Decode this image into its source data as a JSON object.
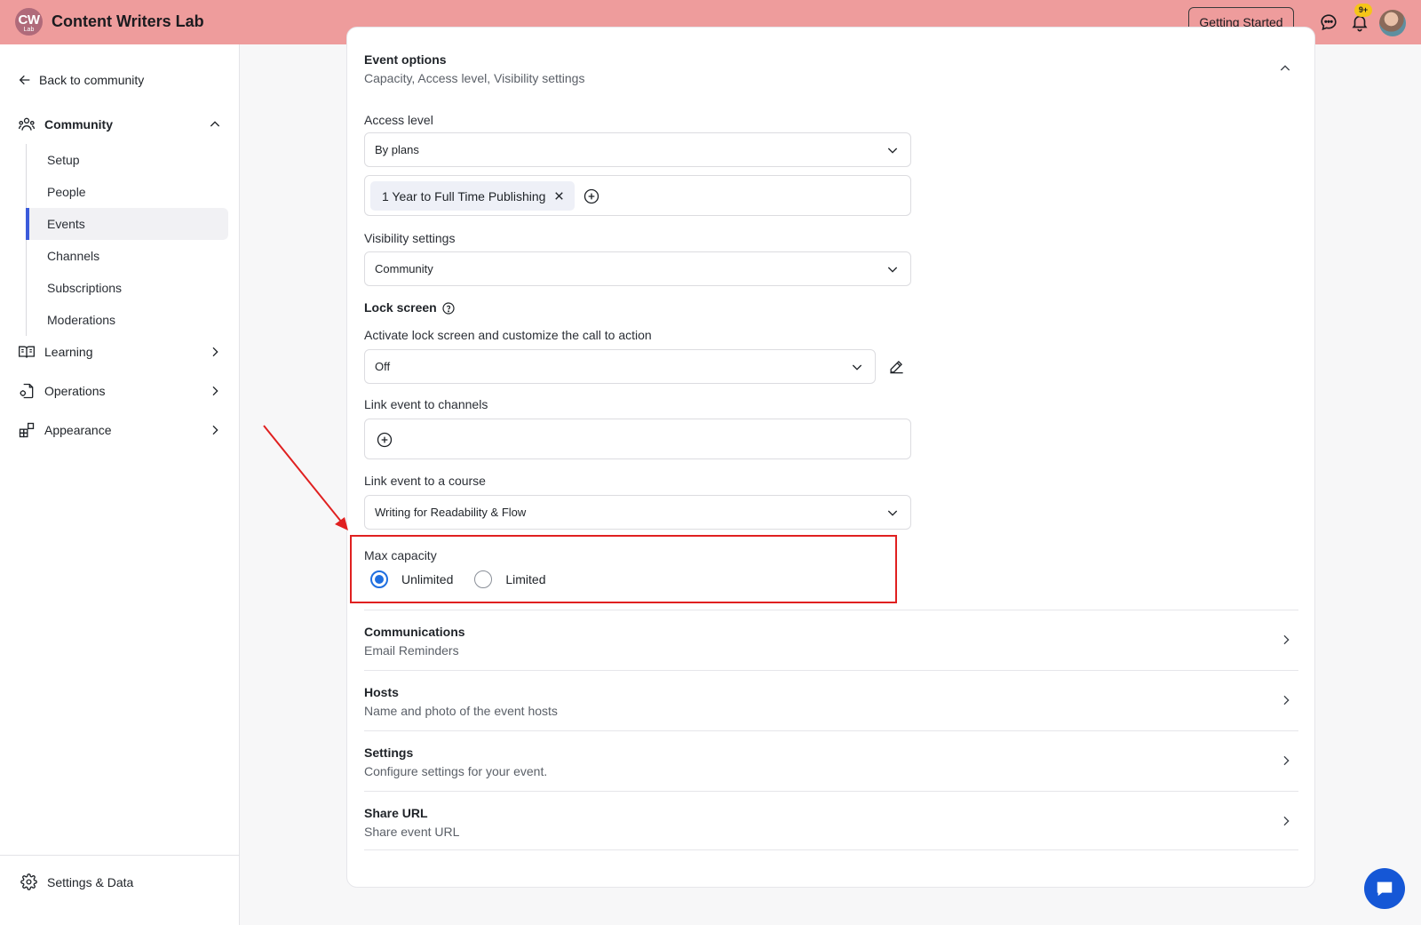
{
  "header": {
    "logo_text": "CW",
    "logo_sub": "Lab",
    "brand": "Content Writers Lab",
    "getting_started": "Getting Started",
    "notif_badge": "9+"
  },
  "sidebar": {
    "back": "Back to community",
    "community": "Community",
    "community_items": [
      "Setup",
      "People",
      "Events",
      "Channels",
      "Subscriptions",
      "Moderations"
    ],
    "active_item": "Events",
    "learning": "Learning",
    "operations": "Operations",
    "appearance": "Appearance",
    "settings": "Settings & Data"
  },
  "event_options": {
    "title": "Event options",
    "subtitle": "Capacity, Access level, Visibility settings",
    "access_level_label": "Access level",
    "access_level_value": "By plans",
    "plan_chip": "1 Year to Full Time Publishing",
    "visibility_label": "Visibility settings",
    "visibility_value": "Community",
    "lock_screen_label": "Lock screen",
    "lock_screen_desc": "Activate lock screen and customize the call to action",
    "lock_screen_value": "Off",
    "link_channels_label": "Link event to channels",
    "link_course_label": "Link event to a course",
    "link_course_value": "Writing for Readability & Flow",
    "max_capacity_label": "Max capacity",
    "capacity_options": [
      "Unlimited",
      "Limited"
    ],
    "capacity_selected": "Unlimited"
  },
  "sections": [
    {
      "title": "Communications",
      "subtitle": "Email Reminders"
    },
    {
      "title": "Hosts",
      "subtitle": "Name and photo of the event hosts"
    },
    {
      "title": "Settings",
      "subtitle": "Configure settings for your event."
    },
    {
      "title": "Share URL",
      "subtitle": "Share event URL"
    }
  ],
  "colors": {
    "header_bg": "#ee9c9c",
    "accent": "#3b5bdb",
    "radio_selected": "#1f6fe0",
    "annotation_red": "#e02020",
    "chat_fab": "#1557d6"
  },
  "icons": {
    "chat": "message-bubble-icon",
    "notifications": "bell-icon",
    "help": "question-circle-icon",
    "edit": "pencil-icon",
    "add": "plus-circle-icon",
    "remove": "x-icon"
  }
}
